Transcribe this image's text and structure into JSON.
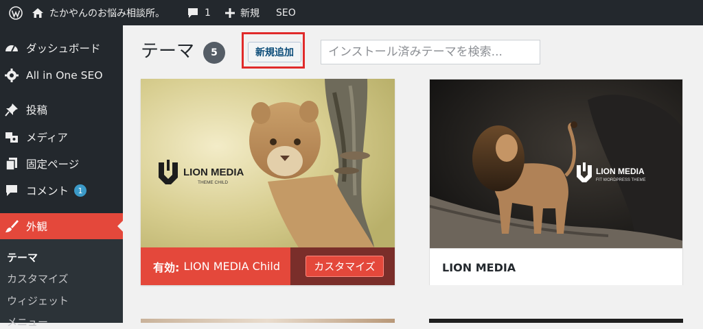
{
  "adminbar": {
    "site_name": "たかやんのお悩み相談所。",
    "comment_count": "1",
    "new_label": "新規",
    "seo_label": "SEO"
  },
  "sidebar": {
    "items": [
      {
        "label": "ダッシュボード",
        "icon": "dashboard-icon"
      },
      {
        "label": "All in One SEO",
        "icon": "gear-icon"
      },
      {
        "label": "投稿",
        "icon": "pin-icon"
      },
      {
        "label": "メディア",
        "icon": "media-icon"
      },
      {
        "label": "固定ページ",
        "icon": "page-icon"
      },
      {
        "label": "コメント",
        "icon": "comment-icon",
        "badge": "1"
      },
      {
        "label": "外観",
        "icon": "brush-icon",
        "active": true
      }
    ],
    "submenu": [
      "テーマ",
      "カスタマイズ",
      "ウィジェット",
      "メニュー"
    ]
  },
  "main": {
    "title": "テーマ",
    "count": "5",
    "add_new": "新規追加",
    "search_placeholder": "インストール済みテーマを検索..."
  },
  "themes": [
    {
      "logo_title": "LION MEDIA",
      "logo_subtitle": "THEME CHILD",
      "active_prefix": "有効:",
      "name": "LION MEDIA Child",
      "customize": "カスタマイズ"
    },
    {
      "logo_title": "LION MEDIA",
      "logo_subtitle": "FIT WORDPRESS THEME",
      "name": "LION MEDIA"
    }
  ],
  "colors": {
    "adminbar_bg": "#23282d",
    "accent_red": "#e4483b",
    "badge_blue": "#3b9ac8",
    "highlight": "#e02a2a"
  }
}
